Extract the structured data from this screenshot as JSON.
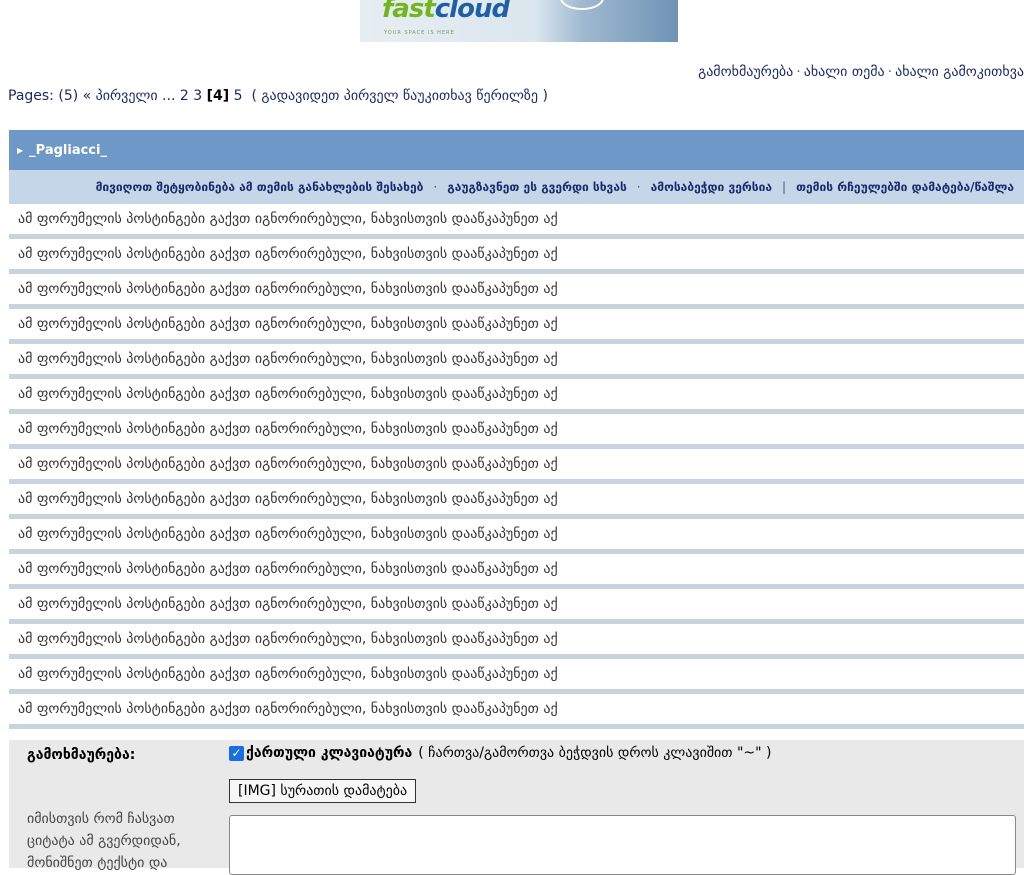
{
  "logo": {
    "word_fast": "fast",
    "word_cloud": "cloud",
    "tagline": "YOUR SPACE IS HERE"
  },
  "top_links": {
    "reply": "გამოხმაურება",
    "new_topic": "ახალი თემა",
    "new_poll": "ახალი გამოკითხვა"
  },
  "pagination": {
    "prefix": "Pages: (5)",
    "first": "« პირველი",
    "ellipsis": "...",
    "pages": [
      "2",
      "3"
    ],
    "current": "[4]",
    "next_page": "5",
    "goto_first_unread": "( გადავიდეთ პირველ წაუკითხავ წერილზე )"
  },
  "topic": {
    "title": "_Pagliacci_",
    "options": {
      "track": "მივიღოთ შეტყობინება ამ თემის განახლების შესახებ",
      "send": "გაუგზავნეთ ეს გვერდი სხვას",
      "print": "ამოსაბეჭდი ვერსია",
      "favorites": "თემის რჩეულებში დამატება/წაშლა"
    },
    "ignored_rows": [
      "ამ ფორუმელის პოსტინგები გაქვთ იგნორირებული, ნახვისთვის დააწკაპუნეთ აქ",
      "ამ ფორუმელის პოსტინგები გაქვთ იგნორირებული, ნახვისთვის დააწკაპუნეთ აქ",
      "ამ ფორუმელის პოსტინგები გაქვთ იგნორირებული, ნახვისთვის დააწკაპუნეთ აქ",
      "ამ ფორუმელის პოსტინგები გაქვთ იგნორირებული, ნახვისთვის დააწკაპუნეთ აქ",
      "ამ ფორუმელის პოსტინგები გაქვთ იგნორირებული, ნახვისთვის დააწკაპუნეთ აქ",
      "ამ ფორუმელის პოსტინგები გაქვთ იგნორირებული, ნახვისთვის დააწკაპუნეთ აქ",
      "ამ ფორუმელის პოსტინგები გაქვთ იგნორირებული, ნახვისთვის დააწკაპუნეთ აქ",
      "ამ ფორუმელის პოსტინგები გაქვთ იგნორირებული, ნახვისთვის დააწკაპუნეთ აქ",
      "ამ ფორუმელის პოსტინგები გაქვთ იგნორირებული, ნახვისთვის დააწკაპუნეთ აქ",
      "ამ ფორუმელის პოსტინგები გაქვთ იგნორირებული, ნახვისთვის დააწკაპუნეთ აქ",
      "ამ ფორუმელის პოსტინგები გაქვთ იგნორირებული, ნახვისთვის დააწკაპუნეთ აქ",
      "ამ ფორუმელის პოსტინგები გაქვთ იგნორირებული, ნახვისთვის დააწკაპუნეთ აქ",
      "ამ ფორუმელის პოსტინგები გაქვთ იგნორირებული, ნახვისთვის დააწკაპუნეთ აქ",
      "ამ ფორუმელის პოსტინგები გაქვთ იგნორირებული, ნახვისთვის დააწკაპუნეთ აქ",
      "ამ ფორუმელის პოსტინგები გაქვთ იგნორირებული, ნახვისთვის დააწკაპუნეთ აქ"
    ]
  },
  "quick_reply": {
    "label": "გამოხმაურება:",
    "keyboard_checked": true,
    "keyboard_label": "ქართული კლავიატურა",
    "keyboard_note": "( ჩართვა/გამორთვა ბეჭდვის დროს კლავიშით \"~\" )",
    "img_button": "[IMG] სურათის დამატება",
    "quote_hint": "იმისთვის რომ ჩასვათ ციტატა ამ გვერდიდან, მონიშნეთ ტექსტი და",
    "message_value": ""
  },
  "colors": {
    "header_bar": "#6e98c8",
    "options_bar": "#c4d6e8",
    "row_separator": "#c8d3de",
    "link": "#1b2a6b",
    "checkbox": "#1a6fe0"
  }
}
